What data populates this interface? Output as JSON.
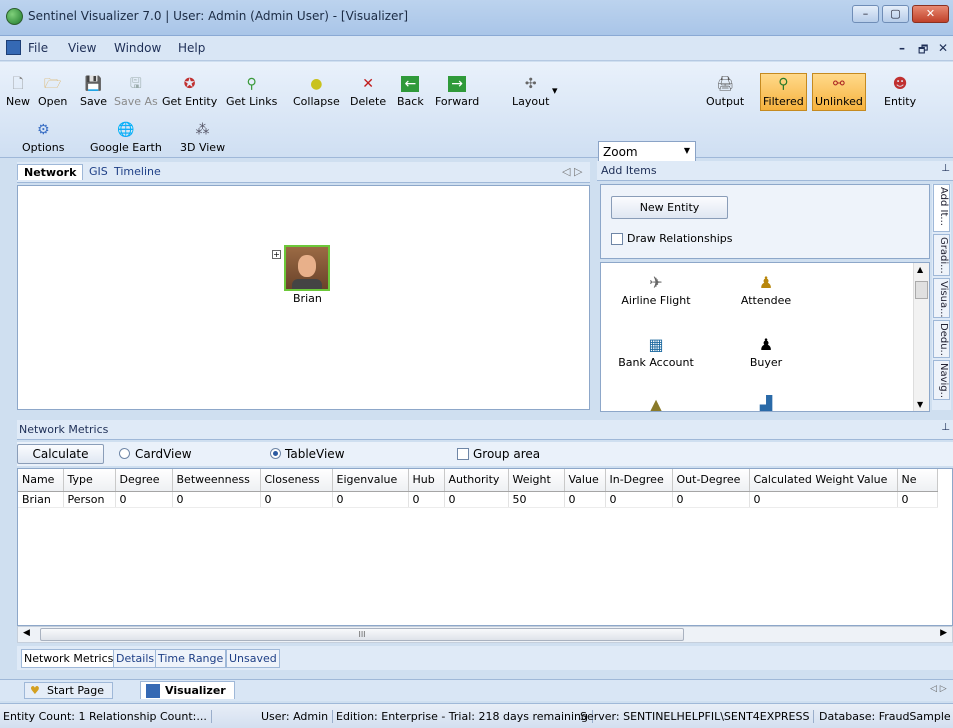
{
  "window": {
    "title": "Sentinel Visualizer 7.0 | User: Admin (Admin User) - [Visualizer]",
    "minimize": "–",
    "maximize": "▢",
    "close": "✕"
  },
  "menu": {
    "items": [
      "File",
      "View",
      "Window",
      "Help"
    ],
    "mdi_min": "–",
    "mdi_restore": "🗗",
    "mdi_close": "✕"
  },
  "toolbar": {
    "new": "New",
    "open": "Open",
    "save": "Save",
    "save_as": "Save As",
    "get_entity": "Get Entity",
    "get_links": "Get Links",
    "collapse": "Collapse",
    "delete": "Delete",
    "back": "Back",
    "forward": "Forward",
    "layout": "Layout",
    "zoom": "Zoom",
    "output": "Output",
    "filtered": "Filtered",
    "unlinked": "Unlinked",
    "entity": "Entity",
    "options": "Options",
    "google_earth": "Google Earth",
    "view_3d": "3D View"
  },
  "view_tabs": [
    "Network",
    "GIS",
    "Timeline"
  ],
  "network": {
    "node_label": "Brian",
    "expand": "+"
  },
  "add_items": {
    "header": "Add Items",
    "new_entity": "New Entity",
    "draw_relationships": "Draw Relationships",
    "items": [
      "Airline Flight",
      "Attendee",
      "Bank Account",
      "Buyer"
    ],
    "side_tabs": [
      "Add It...",
      "Gradi...",
      "Visua...",
      "Dedu...",
      "Navig..."
    ],
    "pin": "📌"
  },
  "metrics": {
    "header": "Network Metrics",
    "calculate": "Calculate",
    "card_view": "CardView",
    "table_view": "TableView",
    "group_area": "Group area",
    "columns": [
      "Name",
      "Type",
      "Degree",
      "Betweenness",
      "Closeness",
      "Eigenvalue",
      "Hub",
      "Authority",
      "Weight",
      "Value",
      "In-Degree",
      "Out-Degree",
      "Calculated Weight Value",
      "Ne"
    ],
    "rows": [
      [
        "Brian",
        "Person",
        "0",
        "0",
        "0",
        "0",
        "0",
        "0",
        "50",
        "0",
        "0",
        "0",
        "0",
        "0"
      ]
    ],
    "scroll_grip": "III"
  },
  "bottom_tabs": [
    "Network Metrics",
    "Details",
    "Time Range",
    "Unsaved"
  ],
  "doc_tabs": [
    "Start Page",
    "Visualizer"
  ],
  "status": {
    "entity_count": "Entity Count: 1 Relationship Count:...",
    "user": "User:  Admin",
    "edition": "Edition: Enterprise - Trial: 218 days remaining",
    "server": "Server: SENTINELHELPFIL\\SENT4EXPRESS",
    "database": "Database: FraudSample"
  }
}
